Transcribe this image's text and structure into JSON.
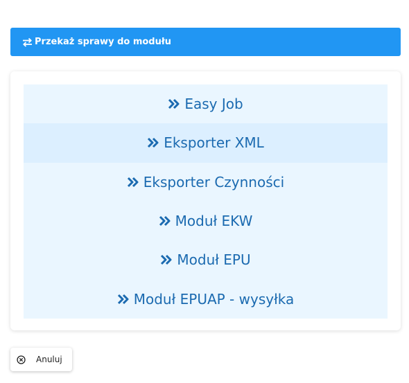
{
  "header": {
    "title": "Przekaż sprawy do modułu",
    "icon": "exchange-arrows-icon"
  },
  "modules": [
    {
      "label": "Easy Job",
      "icon": "double-chevron-right-icon"
    },
    {
      "label": "Eksporter XML",
      "icon": "double-chevron-right-icon"
    },
    {
      "label": "Eksporter Czynności",
      "icon": "double-chevron-right-icon"
    },
    {
      "label": "Moduł EKW",
      "icon": "double-chevron-right-icon"
    },
    {
      "label": "Moduł EPU",
      "icon": "double-chevron-right-icon"
    },
    {
      "label": "Moduł EPUAP - wysyłka",
      "icon": "double-chevron-right-icon"
    }
  ],
  "cancel": {
    "label": "Anuluj",
    "icon": "close-circle-icon"
  },
  "colors": {
    "accent": "#2196f3",
    "item_bg": "#eaf6ff",
    "item_hover_bg": "#dcefff",
    "item_text": "#1b6ab0"
  }
}
